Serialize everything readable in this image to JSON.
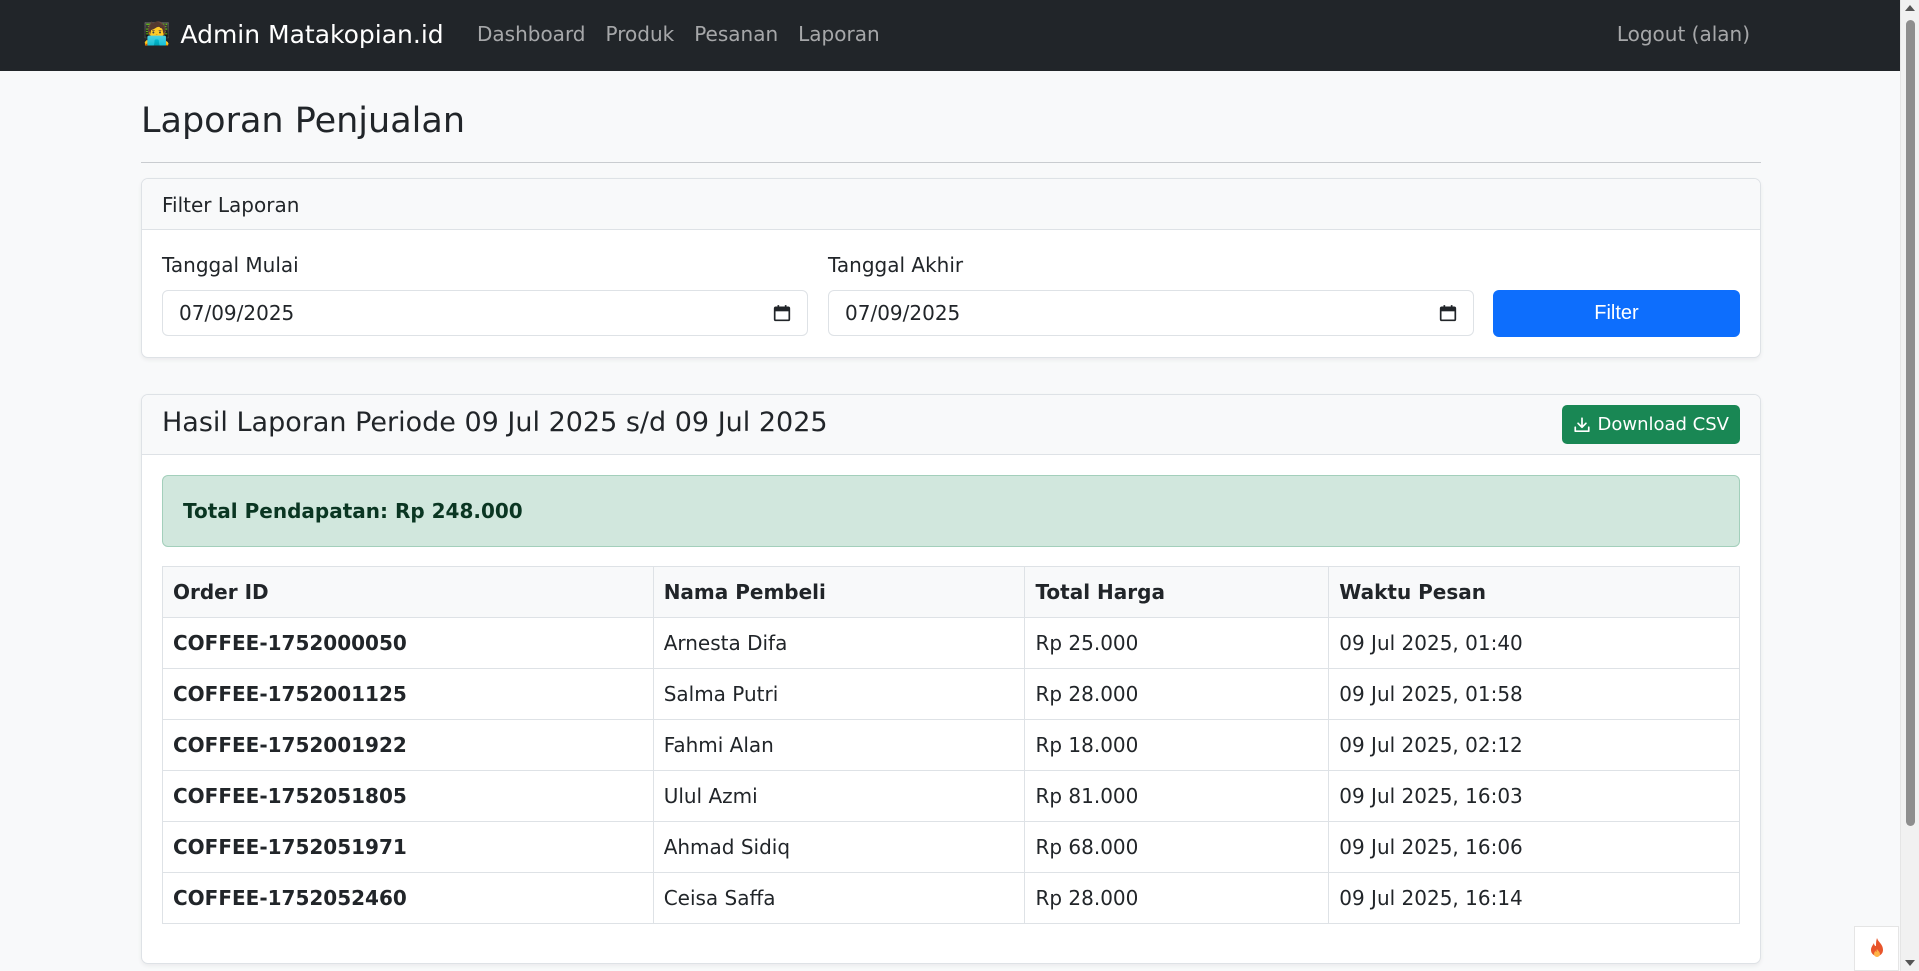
{
  "navbar": {
    "brand_icon": "🧑‍💻",
    "brand": "Admin Matakopian.id",
    "links": [
      "Dashboard",
      "Produk",
      "Pesanan",
      "Laporan"
    ],
    "logout": "Logout (alan)"
  },
  "page_title": "Laporan Penjualan",
  "filter": {
    "header": "Filter Laporan",
    "start_label": "Tanggal Mulai",
    "start_value": "07/09/2025",
    "end_label": "Tanggal Akhir",
    "end_value": "07/09/2025",
    "button": "Filter"
  },
  "result": {
    "title": "Hasil Laporan Periode 09 Jul 2025 s/d 09 Jul 2025",
    "download": "Download CSV",
    "total": "Total Pendapatan: Rp 248.000",
    "columns": [
      "Order ID",
      "Nama Pembeli",
      "Total Harga",
      "Waktu Pesan"
    ],
    "rows": [
      [
        "COFFEE-1752000050",
        "Arnesta Difa",
        "Rp 25.000",
        "09 Jul 2025, 01:40"
      ],
      [
        "COFFEE-1752001125",
        "Salma Putri",
        "Rp 28.000",
        "09 Jul 2025, 01:58"
      ],
      [
        "COFFEE-1752001922",
        "Fahmi Alan",
        "Rp 18.000",
        "09 Jul 2025, 02:12"
      ],
      [
        "COFFEE-1752051805",
        "Ulul Azmi",
        "Rp 81.000",
        "09 Jul 2025, 16:03"
      ],
      [
        "COFFEE-1752051971",
        "Ahmad Sidiq",
        "Rp 68.000",
        "09 Jul 2025, 16:06"
      ],
      [
        "COFFEE-1752052460",
        "Ceisa Saffa",
        "Rp 28.000",
        "09 Jul 2025, 16:14"
      ]
    ]
  },
  "colors": {
    "navbar": "#212529",
    "primary": "#0d6efd",
    "success": "#198754",
    "alert_bg": "#d1e7dd"
  }
}
